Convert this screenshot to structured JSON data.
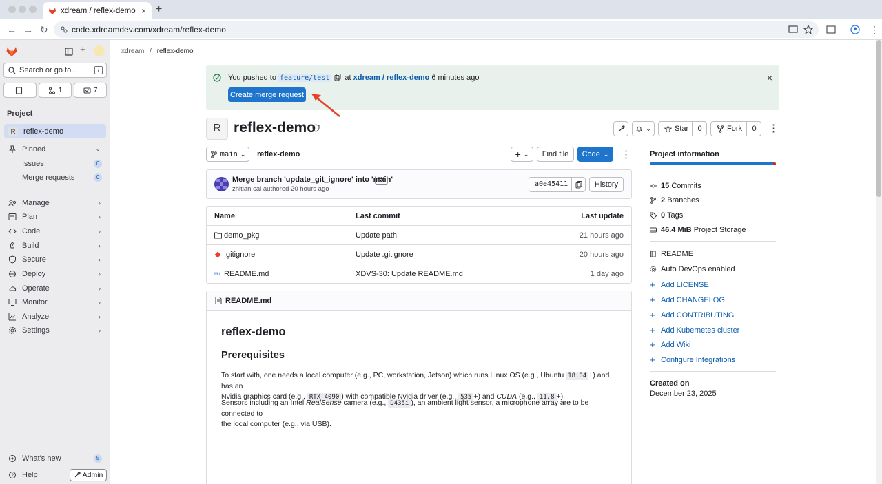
{
  "browser": {
    "tab_title": "xdream / reflex-demo · GitLab",
    "url": "code.xdreamdev.com/xdream/reflex-demo"
  },
  "sidebar": {
    "search_placeholder": "Search or go to...",
    "search_kbd": "/",
    "counts": {
      "issues": "",
      "merge_requests": "1",
      "todos": "7"
    },
    "heading": "Project",
    "project_item": "reflex-demo",
    "project_initial": "R",
    "pinned": "Pinned",
    "pinned_items": [
      {
        "label": "Issues",
        "badge": "0"
      },
      {
        "label": "Merge requests",
        "badge": "0"
      }
    ],
    "menu": [
      "Manage",
      "Plan",
      "Code",
      "Build",
      "Secure",
      "Deploy",
      "Operate",
      "Monitor",
      "Analyze",
      "Settings"
    ],
    "whats_new": "What's new",
    "whats_new_badge": "5",
    "help": "Help",
    "admin": "Admin"
  },
  "breadcrumb": {
    "group": "xdream",
    "separator": "/",
    "project": "reflex-demo"
  },
  "alert": {
    "prefix": "You pushed to",
    "branch": "feature/test",
    "at": "at",
    "repo_link": "xdream / reflex-demo",
    "time": "6 minutes ago",
    "button": "Create merge request"
  },
  "project": {
    "initial": "R",
    "name": "reflex-demo",
    "star_label": "Star",
    "star_count": "0",
    "fork_label": "Fork",
    "fork_count": "0"
  },
  "repo_toolbar": {
    "branch": "main",
    "path": "reflex-demo",
    "add": "+",
    "find_file": "Find file",
    "code": "Code"
  },
  "last_commit": {
    "message": "Merge branch 'update_git_ignore' into 'main'",
    "author": "zhitian cai",
    "authored": "authored",
    "time": "20 hours ago",
    "sha": "a0e45411",
    "history": "History"
  },
  "file_table": {
    "headers": [
      "Name",
      "Last commit",
      "Last update"
    ],
    "rows": [
      {
        "name": "demo_pkg",
        "commit": "Update path",
        "updated": "21 hours ago",
        "icon": "folder-icon"
      },
      {
        "name": ".gitignore",
        "commit": "Update .gitignore",
        "updated": "20 hours ago",
        "icon": "git-icon"
      },
      {
        "name": "README.md",
        "commit": "XDVS-30: Update README.md",
        "updated": "1 day ago",
        "icon": "markdown-icon"
      }
    ]
  },
  "readme": {
    "filename": "README.md",
    "title": "reflex-demo",
    "h2": "Prerequisites",
    "p1": {
      "a": "To start with, one needs a local computer (e.g., PC, workstation, Jetson) which runs Linux OS (e.g., Ubuntu ",
      "c1": "18.04",
      "b": "+) and has an",
      "c": "Nvidia graphics card (e.g., ",
      "c2": "RTX 4090",
      "d": ") with compatible Nvidia driver (e.g., ",
      "c3": "535",
      "e": "+) and ",
      "em": "CUDA",
      "f": " (e.g., ",
      "c4": "11.8",
      "g": "+)."
    },
    "p2": {
      "a": "Sensors including an Intel ",
      "em": "RealSense",
      "b": " camera (e.g., ",
      "c1": "D435i",
      "c": "), an ambient light sensor, a microphone array are to be connected to",
      "d": "the local computer (e.g., via USB)."
    }
  },
  "project_info": {
    "heading": "Project information",
    "stats": [
      {
        "num": "15",
        "label": "Commits",
        "icon": "commit-icon"
      },
      {
        "num": "2",
        "label": "Branches",
        "icon": "branch-icon"
      },
      {
        "num": "0",
        "label": "Tags",
        "icon": "tag-icon"
      },
      {
        "num": "46.4 MiB",
        "label": "Project Storage",
        "icon": "storage-icon"
      }
    ],
    "readme": "README",
    "auto_devops": "Auto DevOps enabled",
    "links": [
      "Add LICENSE",
      "Add CHANGELOG",
      "Add CONTRIBUTING",
      "Add Kubernetes cluster",
      "Add Wiki",
      "Configure Integrations"
    ],
    "created_label": "Created on",
    "created_date": "December 23, 2025"
  },
  "colors": {
    "accent": "#1f75cb",
    "sidebar_bg": "#ececef",
    "alert_bg": "#e8f1ec",
    "arrow": "#e8402a"
  }
}
